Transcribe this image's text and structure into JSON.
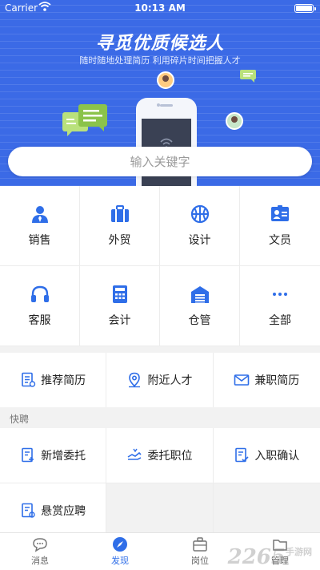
{
  "status_bar": {
    "carrier": "Carrier",
    "time": "10:13 AM",
    "wifi_icon": "wifi-icon",
    "battery_icon": "battery-icon"
  },
  "hero": {
    "title": "寻觅优质候选人",
    "subtitle": "随时随地处理简历 利用碎片时间把握人才"
  },
  "search": {
    "placeholder": "输入关键字"
  },
  "categories": [
    {
      "label": "销售",
      "icon": "person-icon"
    },
    {
      "label": "外贸",
      "icon": "briefcase-icon"
    },
    {
      "label": "设计",
      "icon": "basketball-icon"
    },
    {
      "label": "文员",
      "icon": "id-card-icon"
    },
    {
      "label": "客服",
      "icon": "headphones-icon"
    },
    {
      "label": "会计",
      "icon": "calculator-icon"
    },
    {
      "label": "仓管",
      "icon": "warehouse-icon"
    },
    {
      "label": "全部",
      "icon": "more-dots-icon"
    }
  ],
  "resume_links": [
    {
      "label": "推荐简历",
      "icon": "document-icon"
    },
    {
      "label": "附近人才",
      "icon": "location-pin-icon"
    },
    {
      "label": "兼职简历",
      "icon": "envelope-icon"
    }
  ],
  "quick_hire": {
    "section_label": "快聘",
    "items": [
      {
        "label": "新增委托",
        "icon": "document-add-icon"
      },
      {
        "label": "委托职位",
        "icon": "handshake-icon"
      },
      {
        "label": "入职确认",
        "icon": "document-check-icon"
      },
      {
        "label": "悬赏应聘",
        "icon": "document-reward-icon"
      }
    ]
  },
  "tabbar": {
    "tabs": [
      {
        "label": "消息",
        "icon": "chat-bubble-icon",
        "active": false
      },
      {
        "label": "发现",
        "icon": "compass-icon",
        "active": true
      },
      {
        "label": "岗位",
        "icon": "briefcase-icon",
        "active": false
      },
      {
        "label": "管理",
        "icon": "folder-icon",
        "active": false
      }
    ]
  },
  "watermark": {
    "text": "2265",
    "sub": "手游网"
  },
  "colors": {
    "brand_blue": "#3b6ae6",
    "icon_blue": "#2f6ee8",
    "active_tab": "#2f6ee8"
  }
}
